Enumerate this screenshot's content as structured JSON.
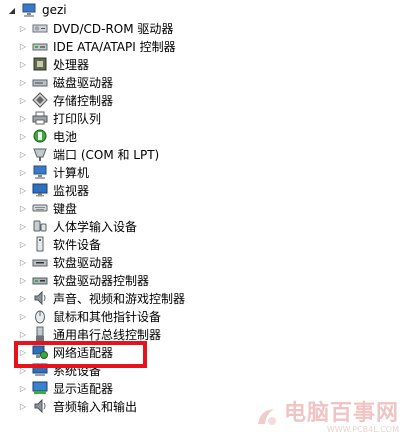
{
  "root": {
    "label": "gezi",
    "icon": "computer-icon"
  },
  "devices": [
    {
      "label": "DVD/CD-ROM 驱动器",
      "icon": "optical-drive-icon"
    },
    {
      "label": "IDE ATA/ATAPI 控制器",
      "icon": "ide-controller-icon"
    },
    {
      "label": "处理器",
      "icon": "processor-icon"
    },
    {
      "label": "磁盘驱动器",
      "icon": "disk-drive-icon"
    },
    {
      "label": "存储控制器",
      "icon": "storage-controller-icon"
    },
    {
      "label": "打印队列",
      "icon": "printer-icon"
    },
    {
      "label": "电池",
      "icon": "battery-icon"
    },
    {
      "label": "端口 (COM 和 LPT)",
      "icon": "port-icon"
    },
    {
      "label": "计算机",
      "icon": "computer-icon"
    },
    {
      "label": "监视器",
      "icon": "monitor-icon"
    },
    {
      "label": "键盘",
      "icon": "keyboard-icon"
    },
    {
      "label": "人体学输入设备",
      "icon": "hid-icon"
    },
    {
      "label": "软件设备",
      "icon": "software-device-icon"
    },
    {
      "label": "软盘驱动器",
      "icon": "floppy-drive-icon"
    },
    {
      "label": "软盘驱动器控制器",
      "icon": "floppy-controller-icon"
    },
    {
      "label": "声音、视频和游戏控制器",
      "icon": "sound-icon"
    },
    {
      "label": "鼠标和其他指针设备",
      "icon": "mouse-icon"
    },
    {
      "label": "通用串行总线控制器",
      "icon": "usb-icon"
    },
    {
      "label": "网络适配器",
      "icon": "network-adapter-icon"
    },
    {
      "label": "系统设备",
      "icon": "system-device-icon"
    },
    {
      "label": "显示适配器",
      "icon": "display-adapter-icon"
    },
    {
      "label": "音频输入和输出",
      "icon": "audio-io-icon"
    }
  ],
  "highlight_color": "#e8121b",
  "watermark": {
    "main": "电脑百事网",
    "sub": "WWW.PCB4L.COM"
  }
}
